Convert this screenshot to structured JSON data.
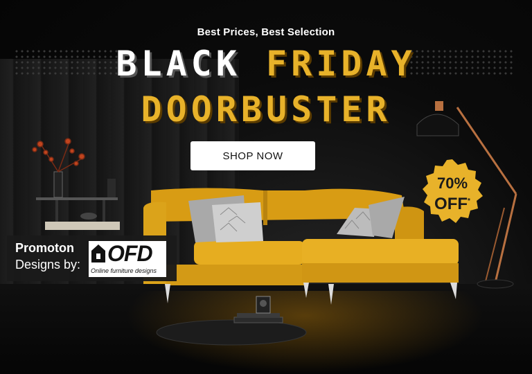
{
  "banner": {
    "tagline": "Best Prices, Best Selection",
    "headline_line1_word1": "BLACK",
    "headline_line1_word2": "FRIDAY",
    "headline_line2": "DOORBUSTER",
    "cta_label": "SHOP NOW",
    "badge": {
      "percent": "70%",
      "off": "OFF",
      "asterisk": "*"
    },
    "promo": {
      "line1": "Promoton",
      "line2": "Designs by:",
      "logo_text": "OFD",
      "logo_subtitle": "Online furniture designs"
    },
    "colors": {
      "gold": "#e8b22a",
      "sofa": "#e2a81c",
      "background": "#0a0a0a",
      "badge": "#e8b22a"
    }
  }
}
